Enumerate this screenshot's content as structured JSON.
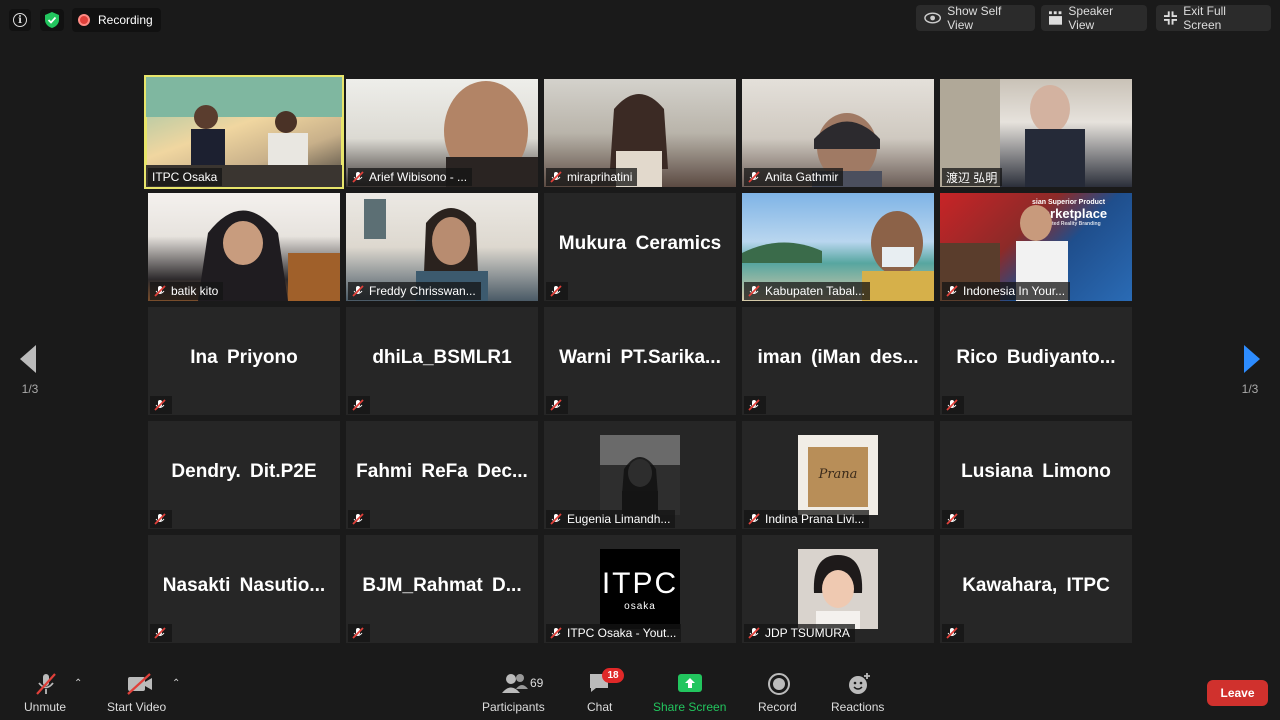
{
  "topbar": {
    "recording_label": "Recording",
    "show_self_view": "Show Self View",
    "speaker_view": "Speaker View",
    "exit_full_screen": "Exit Full Screen"
  },
  "pager": {
    "left": "1/3",
    "right": "1/3"
  },
  "tiles": {
    "t0": {
      "name": "ITPC Osaka"
    },
    "t1": {
      "name": "Arief Wibisono - ..."
    },
    "t2": {
      "name": "miraprihatini"
    },
    "t3": {
      "name": "Anita Gathmir"
    },
    "t4": {
      "name": "渡辺 弘明"
    },
    "t5": {
      "name": "batik kito"
    },
    "t6": {
      "name": "Freddy Chrisswan..."
    },
    "t7": {
      "big": "Mukura Ceramics"
    },
    "t8": {
      "name": "Kabupaten Tabal..."
    },
    "t9": {
      "name": "Indonesia In Your...",
      "screen_line1": "sian Superior Product",
      "screen_line2": "Marketplace",
      "screen_line3": "Augmented Reality Branding"
    },
    "t10": {
      "big": "Ina Priyono"
    },
    "t11": {
      "big": "dhiLa_BSMLR1"
    },
    "t12": {
      "big": "Warni PT.Sarika..."
    },
    "t13": {
      "big": "iman (iMan des..."
    },
    "t14": {
      "big": "Rico Budiyanto..."
    },
    "t15": {
      "big": "Dendry. Dit.P2E"
    },
    "t16": {
      "big": "Fahmi ReFa Dec..."
    },
    "t17": {
      "name": "Eugenia Limandh..."
    },
    "t18": {
      "name": "Indina Prana Livi...",
      "bag_text": "Prana"
    },
    "t19": {
      "big": "Lusiana Limono"
    },
    "t20": {
      "big": "Nasakti Nasutio..."
    },
    "t21": {
      "big": "BJM_Rahmat D..."
    },
    "t22": {
      "name": "ITPC Osaka - Yout...",
      "logo_main": "ITPC",
      "logo_sub": "osaka"
    },
    "t23": {
      "name": "JDP TSUMURA"
    },
    "t24": {
      "big": "Kawahara, ITPC"
    }
  },
  "bottombar": {
    "unmute": "Unmute",
    "start_video": "Start Video",
    "participants": "Participants",
    "participants_count": "69",
    "chat": "Chat",
    "chat_badge": "18",
    "share_screen": "Share Screen",
    "record": "Record",
    "reactions": "Reactions",
    "leave": "Leave"
  },
  "colors": {
    "active_border": "#e8e56b",
    "share_green": "#22c55e",
    "leave_red": "#d0312d",
    "mute_red": "#e0403a",
    "arrow_blue": "#2d8cff"
  }
}
